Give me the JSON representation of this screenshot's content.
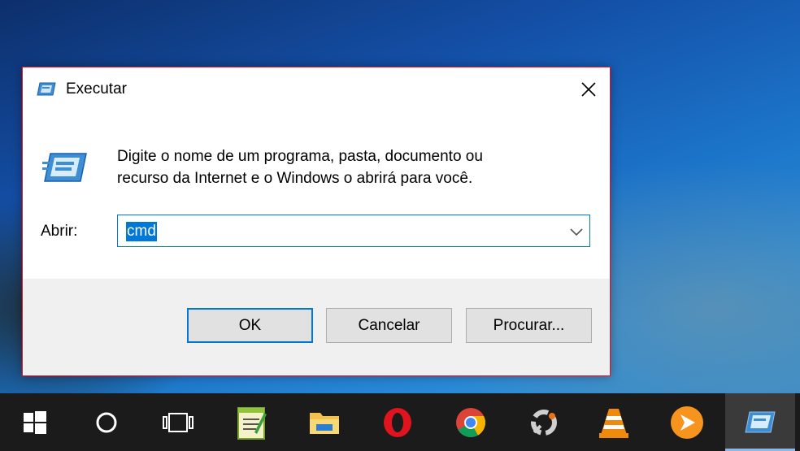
{
  "dialog": {
    "title": "Executar",
    "description_line1": "Digite o nome de um programa, pasta, documento ou",
    "description_line2": "recurso da Internet e o Windows o abrirá para você.",
    "open_label": "Abrir:",
    "open_value": "cmd",
    "buttons": {
      "ok": "OK",
      "cancel": "Cancelar",
      "browse": "Procurar..."
    }
  },
  "taskbar": {
    "items": [
      {
        "icon": "windows-start-icon"
      },
      {
        "icon": "cortana-search-icon"
      },
      {
        "icon": "task-view-icon"
      },
      {
        "icon": "notepad-plus-plus-icon"
      },
      {
        "icon": "file-explorer-icon"
      },
      {
        "icon": "opera-browser-icon"
      },
      {
        "icon": "chrome-browser-icon"
      },
      {
        "icon": "app-ring-icon"
      },
      {
        "icon": "vlc-player-icon"
      },
      {
        "icon": "media-player-icon"
      },
      {
        "icon": "run-dialog-icon",
        "active": true
      }
    ]
  },
  "colors": {
    "accent": "#0078d7",
    "dialog_border": "#e81123",
    "taskbar": "#1b1b1b"
  }
}
